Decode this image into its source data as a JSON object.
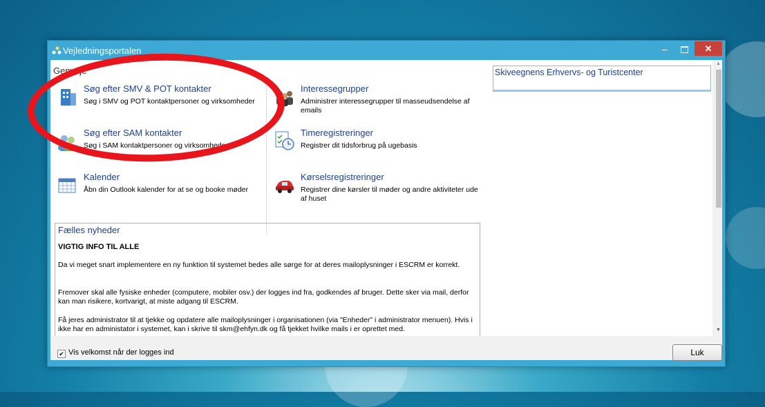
{
  "window": {
    "title": "Vejledningsportalen"
  },
  "section": {
    "title": "Genveje"
  },
  "links_left": [
    {
      "title": "Søg efter SMV & POT kontakter",
      "desc": "Søg i SMV og POT kontaktpersoner og virksomheder",
      "icon": "building-icon"
    },
    {
      "title": "Søg efter SAM kontakter",
      "desc": "Søg i SAM kontaktpersoner og virksomheder",
      "icon": "people-icon"
    },
    {
      "title": "Kalender",
      "desc": "Åbn din Outlook kalender for at se og booke møder",
      "icon": "calendar-icon"
    }
  ],
  "links_right": [
    {
      "title": "Interessegrupper",
      "desc": "Administrer interessegrupper til masseudsendelse af emails",
      "icon": "group-icon"
    },
    {
      "title": "Timeregistreringer",
      "desc": "Registrer dit tidsforbrug på ugebasis",
      "icon": "clock-icon"
    },
    {
      "title": "Kørselsregistreringer",
      "desc": "Registrer dine kørsler til møder og andre aktiviteter ude af huset",
      "icon": "car-icon"
    }
  ],
  "news": {
    "title": "Fælles nyheder",
    "headline": "VIGTIG INFO TIL ALLE",
    "paragraphs": [
      "Da vi meget snart implementere en ny funktion til systemet bedes alle sørge for at deres mailoplysninger i ESCRM er korrekt.",
      "Fremover skal alle fysiske enheder (computere, mobiler osv.) der logges ind fra, godkendes af bruger. Dette sker via mail, derfor kan man risikere, kortvarigt, at miste adgang til ESCRM.",
      "Få jeres administrator til at tjekke og opdatere alle mailoplysninger i organisationen (via \"Enheder\" i administrator menuen). Hvis i ikke har en administator i systemet, kan i skrive til skm@ehfyn.dk og få tjekket hvilke mails i er oprettet med."
    ]
  },
  "sidebox": {
    "title": "Skiveegnens Erhvervs- og Turistcenter"
  },
  "footer": {
    "checkbox_label": "Vis velkomst når der logges ind",
    "checked": true,
    "close_label": "Luk"
  }
}
